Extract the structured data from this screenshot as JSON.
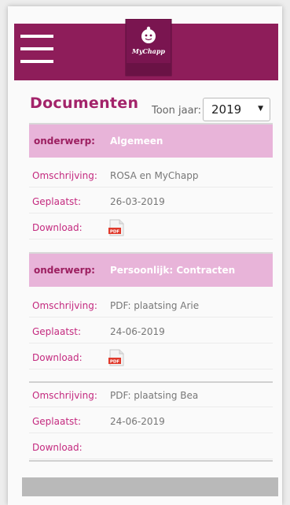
{
  "header": {
    "logo_text": "MyChapp"
  },
  "page": {
    "title": "Documenten",
    "year_label": "Toon jaar:",
    "year_value": "2019"
  },
  "sections": [
    {
      "key": "onderwerp:",
      "value": "Algemeen",
      "documents": [
        {
          "desc_label": "Omschrijving:",
          "desc": "ROSA en MyChapp",
          "date_label": "Geplaatst:",
          "date": "26-03-2019",
          "download_label": "Download:",
          "download_icon": "pdf-icon"
        }
      ]
    },
    {
      "key": "onderwerp:",
      "value": "Persoonlijk: Contracten",
      "documents": [
        {
          "desc_label": "Omschrijving:",
          "desc": "PDF: plaatsing Arie",
          "date_label": "Geplaatst:",
          "date": "24-06-2019",
          "download_label": "Download:",
          "download_icon": "pdf-icon"
        },
        {
          "desc_label": "Omschrijving:",
          "desc": "PDF: plaatsing Bea",
          "date_label": "Geplaatst:",
          "date": "24-06-2019",
          "download_label": "Download:",
          "download_icon": ""
        }
      ]
    }
  ],
  "colors": {
    "brand": "#8e1d5a",
    "accent": "#c42a7f",
    "section_bg": "#e8b4d9"
  }
}
